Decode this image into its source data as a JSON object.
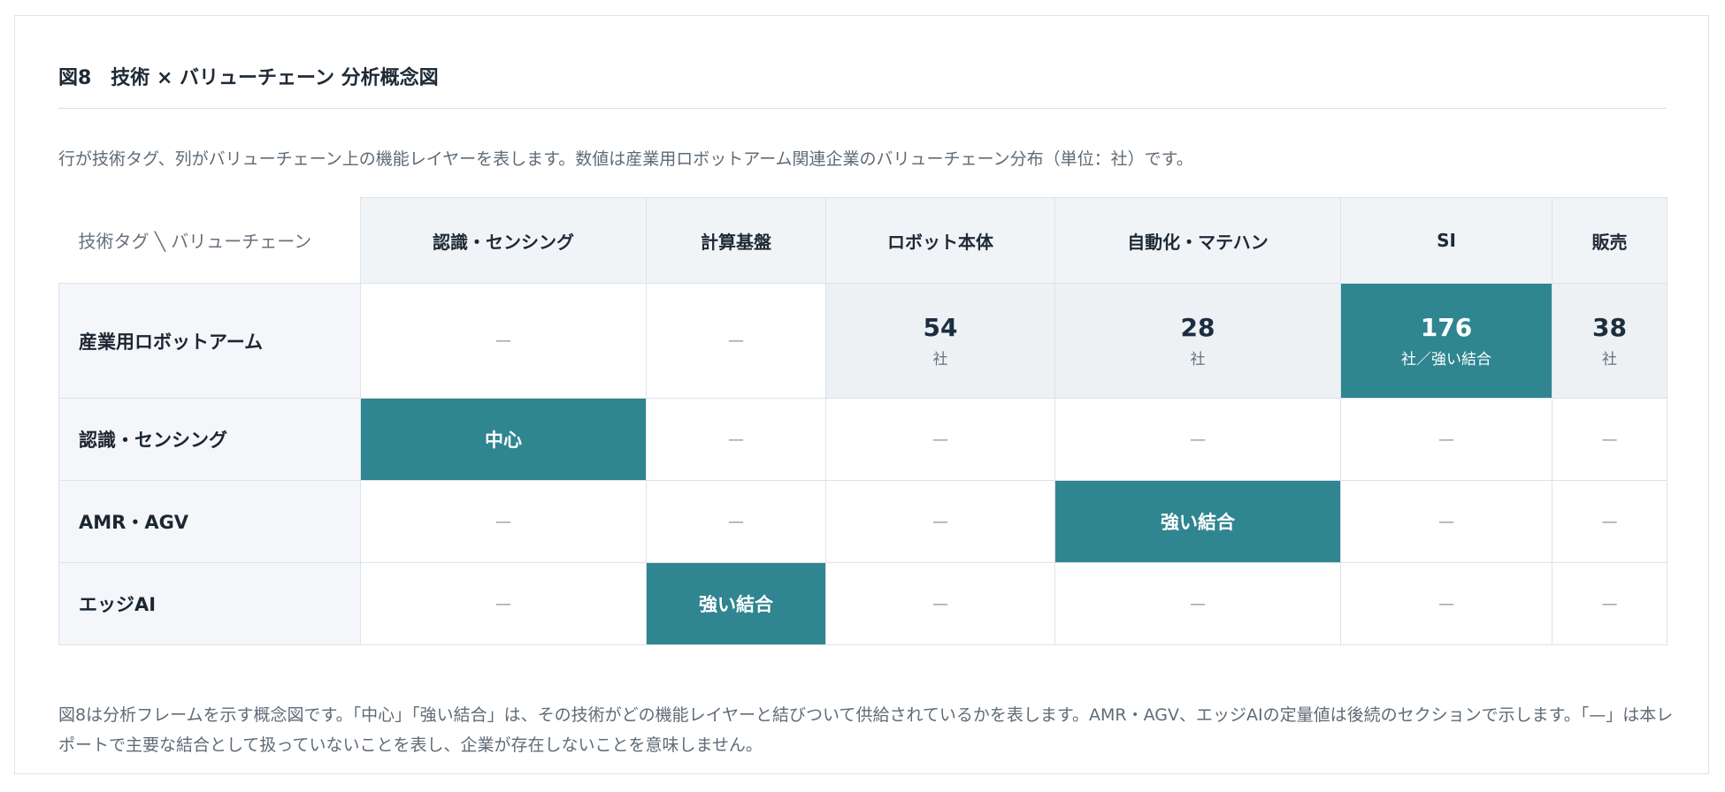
{
  "figure": {
    "title": "図8　技術 × バリューチェーン 分析概念図",
    "description": "行が技術タグ、列がバリューチェーン上の機能レイヤーを表します。数値は産業用ロボットアーム関連企業のバリューチェーン分布（単位：社）です。",
    "footnote": "図8は分析フレームを示す概念図です。「中心」「強い結合」は、その技術がどの機能レイヤーと結びついて供給されているかを表します。AMR・AGV、エッジAIの定量値は後続のセクションで示します。「—」は本レポートで主要な結合として扱っていないことを表し、企業が存在しないことを意味しません。"
  },
  "matrix": {
    "corner_label": "技術タグ ╲ バリューチェーン",
    "columns": [
      "認識・センシング",
      "計算基盤",
      "ロボット本体",
      "自動化・マテハン",
      "SI",
      "販売"
    ],
    "rows": [
      {
        "label": "産業用ロボットアーム",
        "cells": [
          {
            "type": "empty",
            "text": "—"
          },
          {
            "type": "empty",
            "text": "—"
          },
          {
            "type": "count",
            "value": "54",
            "unit": "社"
          },
          {
            "type": "count",
            "value": "28",
            "unit": "社"
          },
          {
            "type": "count-strong",
            "value": "176",
            "unit": "社／強い結合"
          },
          {
            "type": "count",
            "value": "38",
            "unit": "社"
          }
        ]
      },
      {
        "label": "認識・センシング",
        "cells": [
          {
            "type": "strong",
            "text": "中心"
          },
          {
            "type": "empty",
            "text": "—"
          },
          {
            "type": "empty",
            "text": "—"
          },
          {
            "type": "empty",
            "text": "—"
          },
          {
            "type": "empty",
            "text": "—"
          },
          {
            "type": "empty",
            "text": "—"
          }
        ]
      },
      {
        "label": "AMR・AGV",
        "cells": [
          {
            "type": "empty",
            "text": "—"
          },
          {
            "type": "empty",
            "text": "—"
          },
          {
            "type": "empty",
            "text": "—"
          },
          {
            "type": "strong",
            "text": "強い結合"
          },
          {
            "type": "empty",
            "text": "—"
          },
          {
            "type": "empty",
            "text": "—"
          }
        ]
      },
      {
        "label": "エッジAI",
        "cells": [
          {
            "type": "empty",
            "text": "—"
          },
          {
            "type": "strong",
            "text": "強い結合"
          },
          {
            "type": "empty",
            "text": "—"
          },
          {
            "type": "empty",
            "text": "—"
          },
          {
            "type": "empty",
            "text": "—"
          },
          {
            "type": "empty",
            "text": "—"
          }
        ]
      }
    ]
  },
  "colors": {
    "accent_teal": "#2f8590",
    "count_cell_bg": "#edf1f4",
    "header_bg": "#f1f4f7",
    "border": "#dce3e8"
  }
}
